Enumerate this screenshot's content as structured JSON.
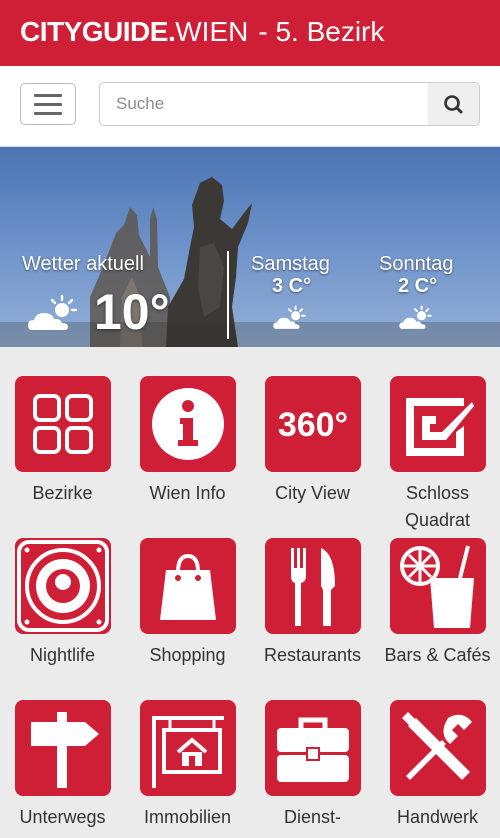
{
  "header": {
    "brand_bold": "CITYGUIDE.",
    "brand_light": "WIEN",
    "district": "- 5. Bezirk",
    "color": "#cf1f36"
  },
  "toolbar": {
    "menu_icon": "hamburger-icon",
    "search_placeholder": "Suche",
    "search_value": "",
    "search_icon": "magnifier-icon"
  },
  "weather": {
    "current_label": "Wetter aktuell",
    "current_temp": "10°",
    "current_icon": "partly-cloudy-icon",
    "forecast": [
      {
        "day": "Samstag",
        "temp": "3 C°",
        "icon": "partly-cloudy-icon"
      },
      {
        "day": "Sonntag",
        "temp": "2 C°",
        "icon": "partly-cloudy-icon"
      }
    ]
  },
  "tiles": [
    {
      "label": "Bezirke",
      "icon": "grid-icon"
    },
    {
      "label": "Wien Info",
      "icon": "info-icon"
    },
    {
      "label": "City View",
      "icon": "360-icon",
      "icon_text": "360°"
    },
    {
      "label": "Schloss Quadrat",
      "icon": "schloss-quadrat-logo-icon"
    },
    {
      "label": "Nightlife",
      "icon": "speaker-icon"
    },
    {
      "label": "Shopping",
      "icon": "shopping-bag-icon"
    },
    {
      "label": "Restaurants",
      "icon": "fork-knife-icon"
    },
    {
      "label": "Bars & Cafés",
      "icon": "drink-icon"
    },
    {
      "label": "Unterwegs",
      "icon": "signpost-icon"
    },
    {
      "label": "Immobilien",
      "icon": "house-sign-icon"
    },
    {
      "label": "Dienst-",
      "icon": "briefcase-icon"
    },
    {
      "label": "Handwerk",
      "icon": "tools-icon"
    }
  ]
}
